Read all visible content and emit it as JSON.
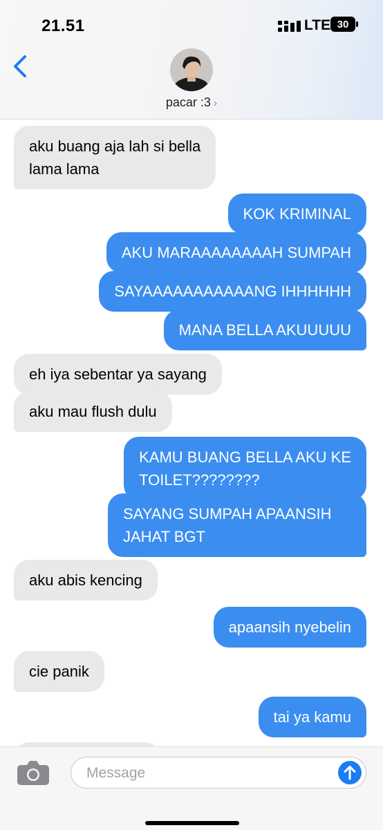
{
  "status_bar": {
    "time": "21.51",
    "network": "LTE",
    "battery_level": "30"
  },
  "header": {
    "contact_name": "pacar :3",
    "chevron": "›"
  },
  "messages": [
    {
      "side": "in",
      "lines": [
        "aku buang aja lah si bella",
        "lama lama"
      ]
    },
    {
      "side": "out",
      "lines": [
        "KOK KRIMINAL"
      ]
    },
    {
      "side": "out",
      "lines": [
        "AKU MARAAAAAAAAH SUMPAH"
      ]
    },
    {
      "side": "out",
      "lines": [
        "SAYAAAAAAAAAAANG IHHHHHH"
      ]
    },
    {
      "side": "out",
      "lines": [
        "MANA BELLA AKUUUUU"
      ]
    },
    {
      "side": "in",
      "lines": [
        "eh iya sebentar ya sayang"
      ]
    },
    {
      "side": "in",
      "lines": [
        "aku mau flush dulu"
      ]
    },
    {
      "side": "out",
      "lines": [
        "KAMU BUANG BELLA AKU KE",
        "TOILET????????"
      ]
    },
    {
      "side": "out",
      "lines": [
        "SAYANG SUMPAH APAANSIH",
        "JAHAT BGT"
      ]
    },
    {
      "side": "in",
      "lines": [
        "aku abis kencing"
      ]
    },
    {
      "side": "out",
      "lines": [
        "apaansih nyebelin"
      ]
    },
    {
      "side": "in",
      "lines": [
        "cie panik"
      ]
    },
    {
      "side": "out",
      "lines": [
        "tai ya kamu"
      ]
    },
    {
      "side": "in",
      "lines": [
        ""
      ]
    }
  ],
  "input": {
    "placeholder": "Message"
  },
  "colors": {
    "outgoing_bubble": "#3b8df0",
    "incoming_bubble": "#e9e9eb",
    "accent": "#1c7cf4"
  },
  "icons": [
    "signal-icon",
    "battery-icon",
    "back-chevron-icon",
    "camera-icon",
    "send-arrow-icon"
  ]
}
